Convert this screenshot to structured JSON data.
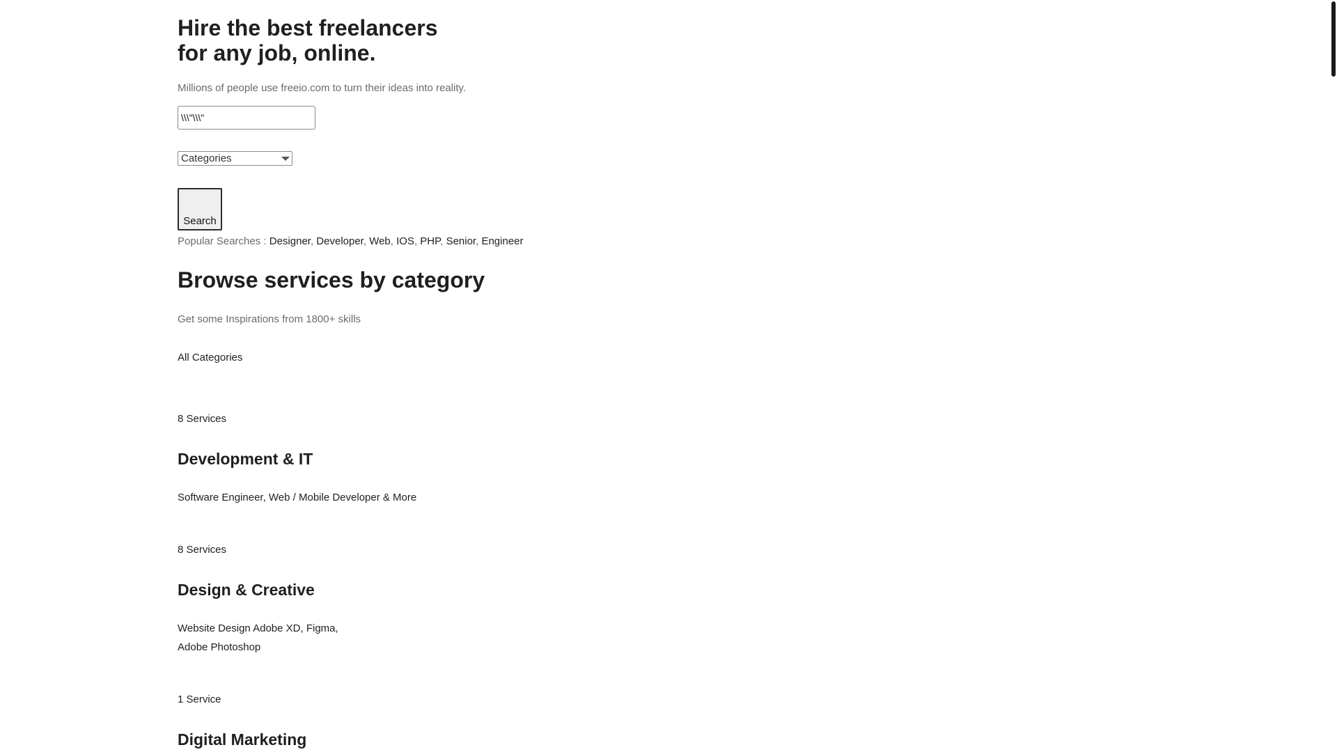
{
  "hero": {
    "title": "Hire the best freelancers for any job, online.",
    "subtitle": "Millions of people use freeio.com to turn their ideas into reality.",
    "search_value": "\\\\\\\"\\\\\\\"",
    "category_selected": "Categories",
    "search_button": "Search",
    "popular_label": "Popular Searches : ",
    "popular_searches": [
      "Designer",
      "Developer",
      "Web",
      "IOS",
      "PHP",
      "Senior",
      "Engineer"
    ],
    "popular_separator": ", "
  },
  "browse": {
    "title": "Browse services by category",
    "subtitle": "Get some Inspirations from 1800+ skills",
    "all_categories_link": "All Categories",
    "categories": [
      {
        "count": "8 Services",
        "title": "Development & IT",
        "description": "Software Engineer, Web / Mobile Developer & More"
      },
      {
        "count": "8 Services",
        "title": "Design & Creative",
        "description": "Website Design Adobe XD, Figma, Adobe Photoshop"
      },
      {
        "count": "1 Service",
        "title": "Digital Marketing",
        "description": ""
      }
    ]
  }
}
